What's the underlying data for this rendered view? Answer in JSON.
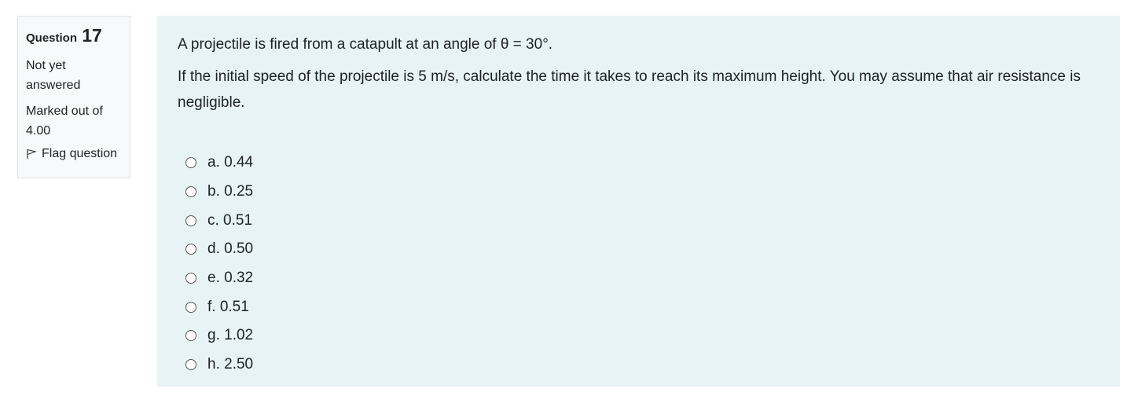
{
  "question_info": {
    "label": "Question",
    "number": "17",
    "status": "Not yet answered",
    "marks": "Marked out of 4.00",
    "flag_label": "Flag question"
  },
  "question": {
    "line1": "A projectile is fired from a catapult at an angle of θ = 30°.",
    "line2": "If the initial speed of the projectile is 5 m/s, calculate the time it takes to reach its maximum height. You may assume that air resistance is negligible."
  },
  "answers": [
    {
      "label": "a. 0.44"
    },
    {
      "label": "b. 0.25"
    },
    {
      "label": "c. 0.51"
    },
    {
      "label": "d. 0.50"
    },
    {
      "label": "e. 0.32"
    },
    {
      "label": "f. 0.51"
    },
    {
      "label": "g. 1.02"
    },
    {
      "label": "h. 2.50"
    }
  ],
  "colors": {
    "content_bg": "#e7f3f5",
    "info_bg": "#f8f9fa",
    "border": "#dee2e6",
    "text": "#1d2125"
  },
  "icons": {
    "flag": "flag-icon",
    "radio": "radio-unchecked-icon"
  }
}
